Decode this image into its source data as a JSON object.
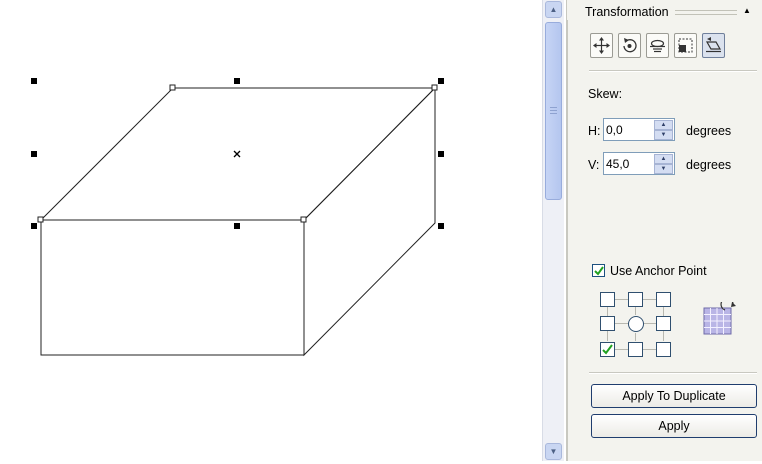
{
  "docker": {
    "title": "Transformation",
    "tools": [
      "position-icon",
      "rotate-icon",
      "scale-mirror-icon",
      "size-icon",
      "skew-icon"
    ],
    "active_tool": "skew-icon",
    "section_label": "Skew:",
    "h_label": "H:",
    "h_value": "0,0",
    "h_unit": "degrees",
    "v_label": "V:",
    "v_value": "45,0",
    "v_unit": "degrees",
    "use_anchor_point_label": "Use Anchor Point",
    "use_anchor_point_checked": true,
    "anchor_selected": "bottom-left",
    "apply_to_duplicate_label": "Apply To Duplicate",
    "apply_label": "Apply"
  }
}
